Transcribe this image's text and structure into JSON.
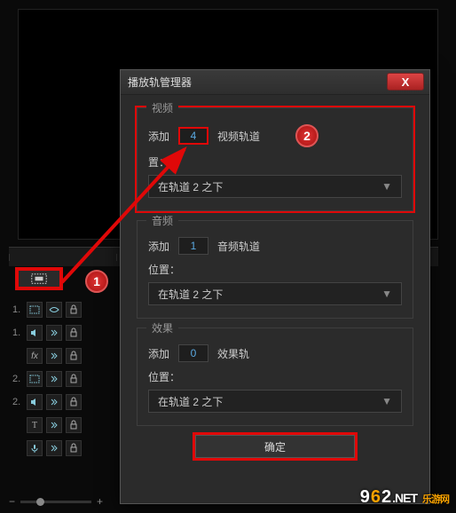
{
  "dialog": {
    "title": "播放轨管理器",
    "close_glyph": "X",
    "sections": {
      "video": {
        "title": "视频",
        "add_label": "添加",
        "add_value": "4",
        "add_suffix": "视频轨道",
        "pos_label": "置：",
        "pos_value": "在轨道 2 之下"
      },
      "audio": {
        "title": "音频",
        "add_label": "添加",
        "add_value": "1",
        "add_suffix": "音频轨道",
        "pos_label": "位置：",
        "pos_value": "在轨道 2 之下"
      },
      "fx": {
        "title": "效果",
        "add_label": "添加",
        "add_value": "0",
        "add_suffix": "效果轨",
        "pos_label": "位置：",
        "pos_value": "在轨道 2 之下"
      }
    },
    "ok_label": "确定"
  },
  "tracks": [
    {
      "num": "1.",
      "type": "video"
    },
    {
      "num": "1.",
      "type": "audio"
    },
    {
      "num": "",
      "type": "fx",
      "label": "fx"
    },
    {
      "num": "2.",
      "type": "video"
    },
    {
      "num": "2.",
      "type": "audio"
    },
    {
      "num": "",
      "type": "title",
      "label": "T"
    },
    {
      "num": "",
      "type": "voice"
    }
  ],
  "annotations": {
    "c1": "1",
    "c2": "2"
  },
  "watermark": {
    "d9": "9",
    "d6": "6",
    "d2": "2",
    "net": ".NET",
    "sub": "乐游网"
  },
  "glyphs": {
    "chev": "▼",
    "minus": "−",
    "plus": "+"
  }
}
